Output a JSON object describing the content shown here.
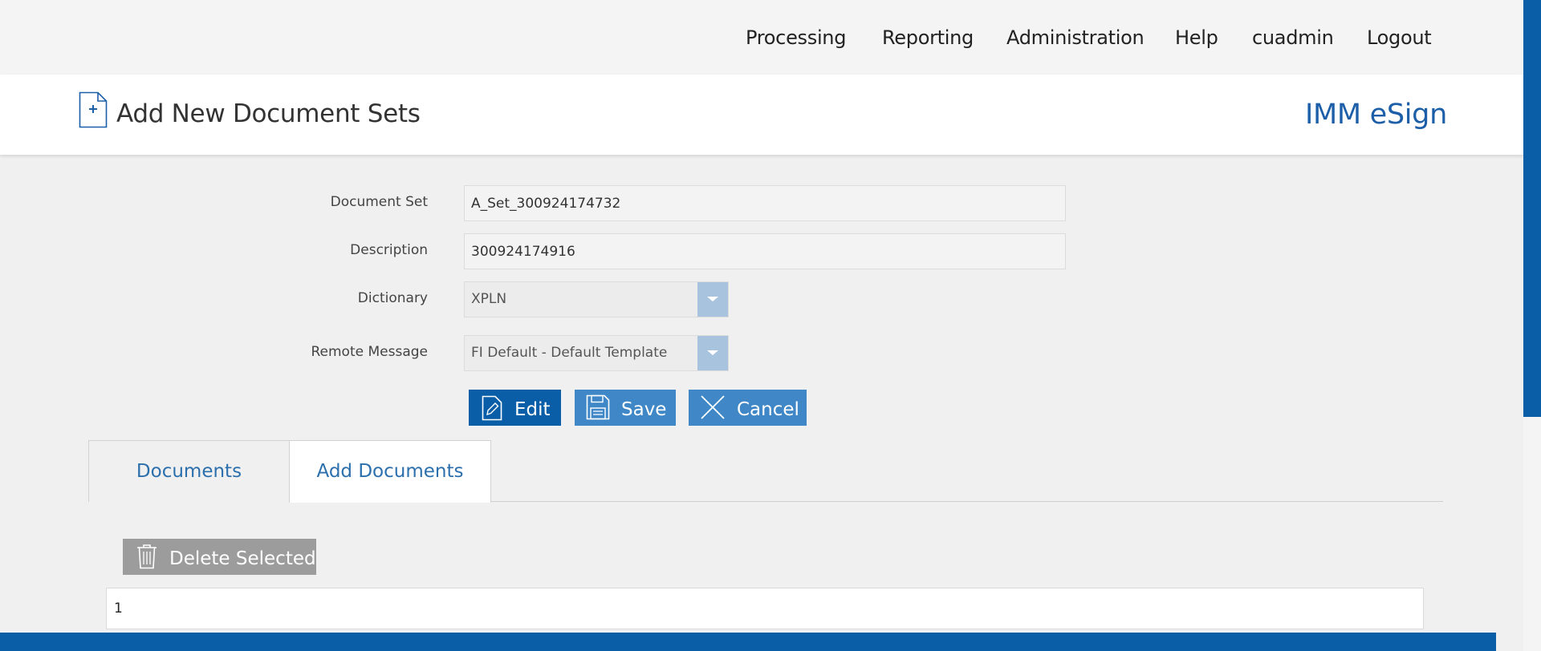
{
  "nav": {
    "items": [
      "Processing",
      "Reporting",
      "Administration",
      "Help",
      "cuadmin",
      "Logout"
    ]
  },
  "header": {
    "title": "Add New Document Sets",
    "brand": "IMM eSign",
    "icon": "add-document-icon"
  },
  "form": {
    "document_set": {
      "label": "Document Set",
      "value": "A_Set_300924174732"
    },
    "description": {
      "label": "Description",
      "value": "300924174916"
    },
    "dictionary": {
      "label": "Dictionary",
      "value": "XPLN"
    },
    "remote_message": {
      "label": "Remote Message",
      "value": "FI Default - Default Template"
    }
  },
  "actions": {
    "edit": "Edit",
    "save": "Save",
    "cancel": "Cancel"
  },
  "tabs": [
    "Documents",
    "Add Documents"
  ],
  "documents": {
    "delete_selected": "Delete Selected",
    "rows": [
      {
        "cell": "1"
      }
    ]
  },
  "colors": {
    "brand_blue": "#0a5ea8",
    "button_blue": "#3f87c6",
    "link_blue": "#2c6fad",
    "disabled_gray": "#9c9c9c"
  }
}
